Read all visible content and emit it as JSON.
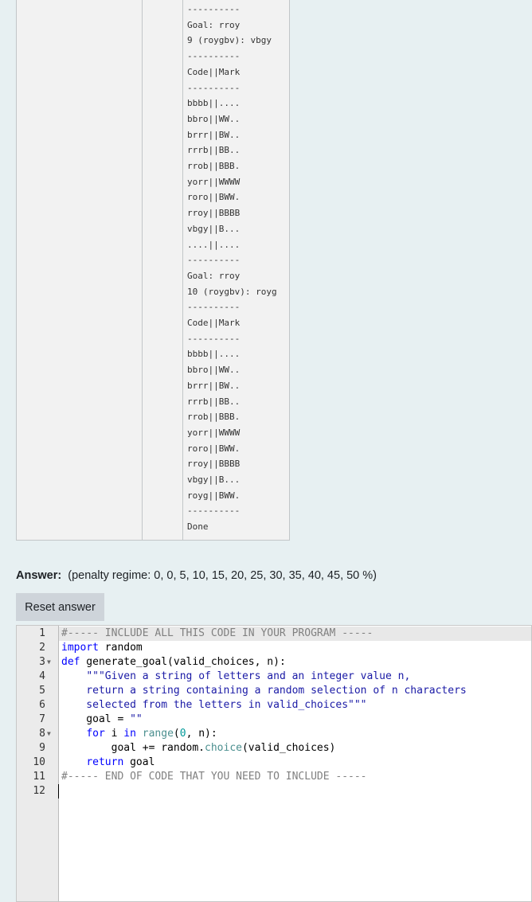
{
  "output_lines": [
    {
      "text": "----------"
    },
    {
      "text": "Goal: rroy"
    },
    {
      "text": "9 (roygbv): vbgy"
    },
    {
      "text": "----------"
    },
    {
      "text": "Code||Mark"
    },
    {
      "text": "----------"
    },
    {
      "text": "bbbb||...."
    },
    {
      "text": "bbro||WW.."
    },
    {
      "text": "brrr||BW.."
    },
    {
      "text": "rrrb||BB.."
    },
    {
      "text": "rrob||BBB."
    },
    {
      "text": "yorr||WWWW"
    },
    {
      "text": "roro||BWW."
    },
    {
      "text": "rroy||BBBB"
    },
    {
      "text": "vbgy||B..."
    },
    {
      "text": "....||...."
    },
    {
      "text": "----------"
    },
    {
      "text": "Goal: rroy"
    },
    {
      "text": "10 (roygbv): royg"
    },
    {
      "text": "----------"
    },
    {
      "text": "Code||Mark"
    },
    {
      "text": "----------"
    },
    {
      "text": "bbbb||...."
    },
    {
      "text": "bbro||WW.."
    },
    {
      "text": "brrr||BW.."
    },
    {
      "text": "rrrb||BB.."
    },
    {
      "text": "rrob||BBB."
    },
    {
      "text": "yorr||WWWW"
    },
    {
      "text": "roro||BWW."
    },
    {
      "text": "rroy||BBBB"
    },
    {
      "text": "vbgy||B..."
    },
    {
      "text": "royg||BWW."
    },
    {
      "text": "----------"
    },
    {
      "text": "Done"
    }
  ],
  "answer": {
    "label": "Answer:",
    "penalty": "(penalty regime: 0, 0, 5, 10, 15, 20, 25, 30, 35, 40, 45, 50 %)",
    "reset_label": "Reset answer"
  },
  "editor": {
    "lines": [
      {
        "num": "1",
        "fold": false,
        "tokens": [
          {
            "c": "tok-c",
            "t": "#----- INCLUDE ALL THIS CODE IN YOUR PROGRAM -----"
          }
        ]
      },
      {
        "num": "2",
        "fold": false,
        "tokens": [
          {
            "c": "tok-k",
            "t": "import"
          },
          {
            "c": "",
            "t": " random"
          }
        ]
      },
      {
        "num": "3",
        "fold": true,
        "tokens": [
          {
            "c": "tok-k",
            "t": "def"
          },
          {
            "c": "",
            "t": " generate_goal(valid_choices, n):"
          }
        ]
      },
      {
        "num": "4",
        "fold": false,
        "tokens": [
          {
            "c": "",
            "t": "    "
          },
          {
            "c": "tok-s",
            "t": "\"\"\"Given a string of letters and an integer value n,"
          }
        ]
      },
      {
        "num": "5",
        "fold": false,
        "tokens": [
          {
            "c": "tok-s",
            "t": "    return a string containing a random selection of n characters"
          }
        ]
      },
      {
        "num": "6",
        "fold": false,
        "tokens": [
          {
            "c": "tok-s",
            "t": "    selected from the letters in valid_choices\"\"\""
          }
        ]
      },
      {
        "num": "7",
        "fold": false,
        "tokens": [
          {
            "c": "",
            "t": "    goal = "
          },
          {
            "c": "tok-s",
            "t": "\"\""
          }
        ]
      },
      {
        "num": "8",
        "fold": true,
        "tokens": [
          {
            "c": "",
            "t": "    "
          },
          {
            "c": "tok-k",
            "t": "for"
          },
          {
            "c": "",
            "t": " i "
          },
          {
            "c": "tok-k",
            "t": "in"
          },
          {
            "c": "",
            "t": " "
          },
          {
            "c": "tok-f",
            "t": "range"
          },
          {
            "c": "",
            "t": "("
          },
          {
            "c": "tok-n",
            "t": "0"
          },
          {
            "c": "",
            "t": ", n):"
          }
        ]
      },
      {
        "num": "9",
        "fold": false,
        "tokens": [
          {
            "c": "",
            "t": "        goal += random."
          },
          {
            "c": "tok-f",
            "t": "choice"
          },
          {
            "c": "",
            "t": "(valid_choices)"
          }
        ]
      },
      {
        "num": "10",
        "fold": false,
        "tokens": [
          {
            "c": "",
            "t": "    "
          },
          {
            "c": "tok-k",
            "t": "return"
          },
          {
            "c": "",
            "t": " goal"
          }
        ]
      },
      {
        "num": "11",
        "fold": false,
        "tokens": [
          {
            "c": "tok-c",
            "t": "#----- END OF CODE THAT YOU NEED TO INCLUDE -----"
          }
        ]
      },
      {
        "num": "12",
        "fold": false,
        "tokens": []
      }
    ]
  }
}
